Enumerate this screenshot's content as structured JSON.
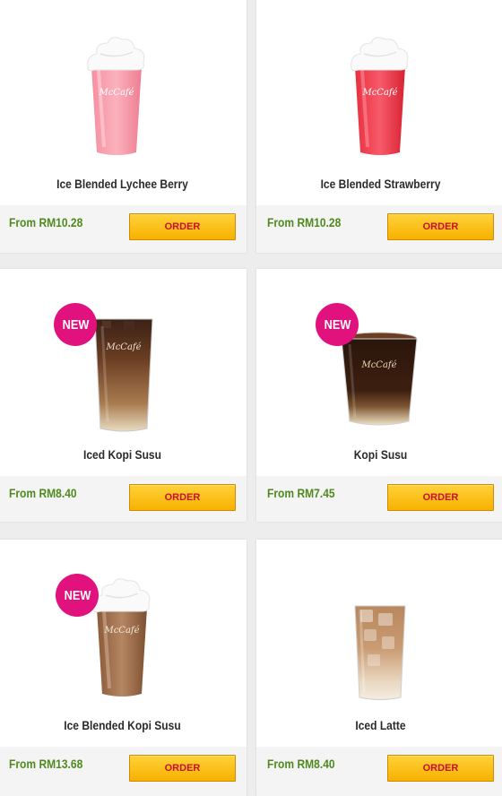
{
  "brand_colors": {
    "order_button": "#f7b100",
    "order_text": "#c8102e",
    "price_text": "#4f8a1f",
    "new_badge": "#e1127d"
  },
  "products": [
    {
      "name": "Ice Blended Lychee Berry",
      "price": "From RM10.28",
      "order_label": "ORDER",
      "badge": "",
      "cup_logo": "McCafé",
      "image": "pink-frappe-with-whipped-cream"
    },
    {
      "name": "Ice Blended Strawberry",
      "price": "From RM10.28",
      "order_label": "ORDER",
      "badge": "",
      "cup_logo": "McCafé",
      "image": "red-frappe-with-whipped-cream"
    },
    {
      "name": "Iced Kopi Susu",
      "price": "From RM8.40",
      "order_label": "ORDER",
      "badge": "NEW",
      "cup_logo": "McCafé",
      "image": "iced-coffee-glass"
    },
    {
      "name": "Kopi Susu",
      "price": "From RM7.45",
      "order_label": "ORDER",
      "badge": "NEW",
      "cup_logo": "McCafé",
      "image": "hot-coffee-glass"
    },
    {
      "name": "Ice Blended Kopi Susu",
      "price": "From RM13.68",
      "order_label": "ORDER",
      "badge": "NEW",
      "cup_logo": "McCafé",
      "image": "coffee-frappe-with-whipped-cream"
    },
    {
      "name": "Iced Latte",
      "price": "From RM8.40",
      "order_label": "ORDER",
      "badge": "",
      "cup_logo": "",
      "image": "iced-latte-glass"
    }
  ]
}
